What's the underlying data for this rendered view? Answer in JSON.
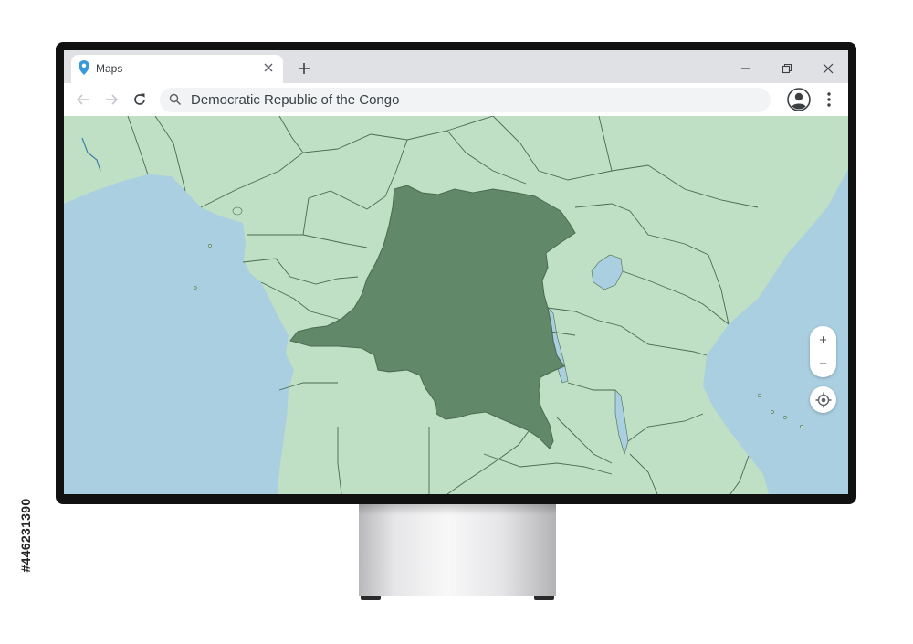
{
  "browser": {
    "tab": {
      "title": "Maps",
      "icon": "map-pin-icon",
      "close_icon": "close-icon"
    },
    "new_tab_icon": "plus-icon",
    "window_controls": [
      "minimize-icon",
      "restore-icon",
      "close-icon"
    ],
    "nav": [
      "back-arrow-icon",
      "forward-arrow-icon",
      "reload-icon"
    ],
    "search": {
      "icon": "search-icon",
      "value": "Democratic Republic of the Congo"
    },
    "profile_icon": "account-icon",
    "menu_icon": "more-vert-icon"
  },
  "map": {
    "highlighted_country": "Democratic Republic of the Congo",
    "colors": {
      "ocean": "#a9cfe0",
      "land": "#bfe0c4",
      "border": "#4a6a52",
      "highlight": "#62886a"
    },
    "controls": {
      "zoom_in": "+",
      "zoom_out": "−",
      "locate_icon": "crosshair-icon"
    }
  },
  "watermark_id": "#446231390"
}
